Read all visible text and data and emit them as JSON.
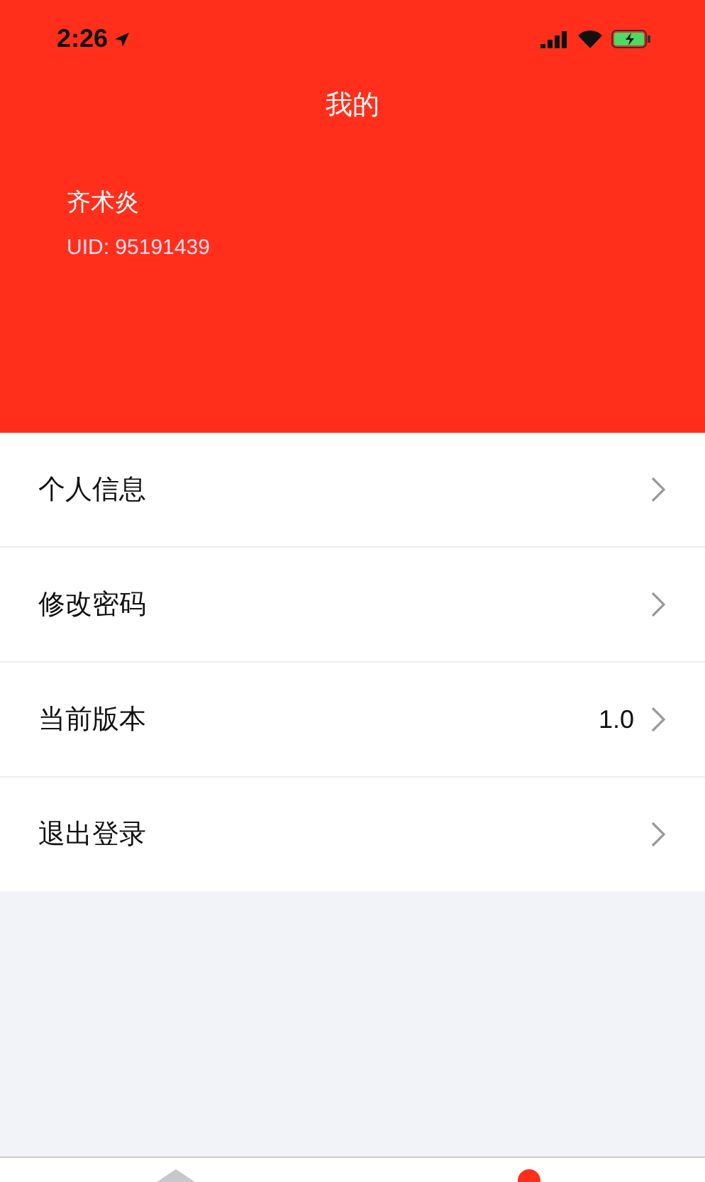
{
  "status_bar": {
    "time": "2:26"
  },
  "header": {
    "title": "我的",
    "name": "齐术炎",
    "uid": "UID: 95191439"
  },
  "menu": [
    {
      "label": "个人信息"
    },
    {
      "label": "修改密码"
    },
    {
      "label": "当前版本",
      "value": "1.0"
    },
    {
      "label": "退出登录"
    }
  ],
  "tab_bar": [
    {
      "selected": false
    },
    {
      "selected": true
    }
  ]
}
